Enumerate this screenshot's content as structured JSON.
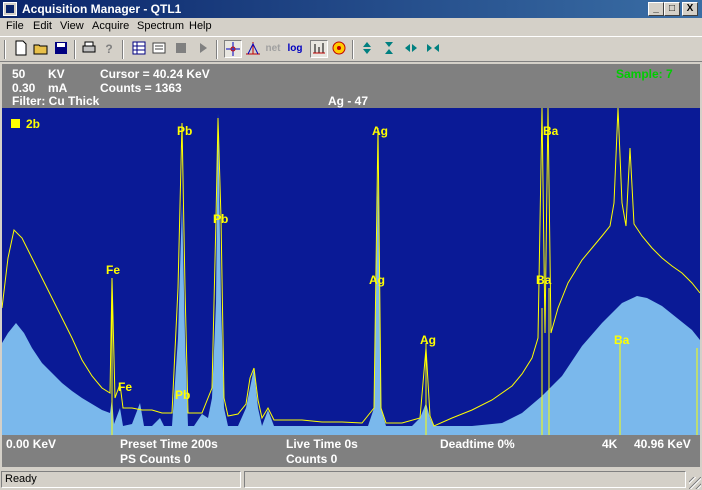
{
  "window": {
    "title": "Acquisition Manager - QTL1",
    "minimize": "_",
    "maximize": "□",
    "close": "X"
  },
  "menu": [
    "File",
    "Edit",
    "View",
    "Acquire",
    "Spectrum",
    "Help"
  ],
  "toolbar_icons": [
    "new-icon",
    "open-icon",
    "save-icon",
    "print-icon",
    "help-icon",
    "grid-icon",
    "list-icon",
    "stop-icon",
    "play-icon",
    "cursor-icon",
    "peak-icon",
    "net-icon",
    "log-icon",
    "marker-icon",
    "target-icon",
    "expand-vertical-icon",
    "compress-vertical-icon",
    "expand-horizontal-icon",
    "compress-horizontal-icon"
  ],
  "toolbar_text": {
    "net": "net",
    "log": "log"
  },
  "info": {
    "kv_value": "50",
    "kv_unit": "KV",
    "ma_value": "0.30",
    "ma_unit": "mA",
    "filter": "Filter: Cu Thick",
    "cursor": "Cursor  =  40.24 KeV",
    "counts": "Counts  =  1363",
    "element": "Ag - 47",
    "sample": "Sample: 7"
  },
  "legend": {
    "label": "2b",
    "color": "#ffff00"
  },
  "peaks": [
    {
      "label": "Pb",
      "energy": 10.55
    },
    {
      "label": "Pb",
      "energy": 12.61
    },
    {
      "label": "Fe",
      "energy": 6.4
    },
    {
      "label": "Fe",
      "energy": 7.06
    },
    {
      "label": "Pb",
      "energy": 10.55
    },
    {
      "label": "Ag",
      "energy": 22.16
    },
    {
      "label": "Ag",
      "energy": 22.16
    },
    {
      "label": "Ag",
      "energy": 24.94
    },
    {
      "label": "Ba",
      "energy": 32.19
    },
    {
      "label": "Ba",
      "energy": 31.82
    },
    {
      "label": "Ba",
      "energy": 36.38
    }
  ],
  "colors": {
    "plot_bg": "#0a1a96",
    "spectrum_fill": "#7ab8ec",
    "overlay_line": "#ffff00",
    "sample_text": "#00cc00"
  },
  "footer": {
    "start": "0.00 KeV",
    "preset_time": "Preset Time 200s",
    "ps_counts": "PS Counts 0",
    "live_time": "Live Time 0s",
    "counts": "Counts 0",
    "deadtime": "Deadtime 0%",
    "channels": "4K",
    "end": "40.96 KeV"
  },
  "status": {
    "text": "Ready"
  }
}
